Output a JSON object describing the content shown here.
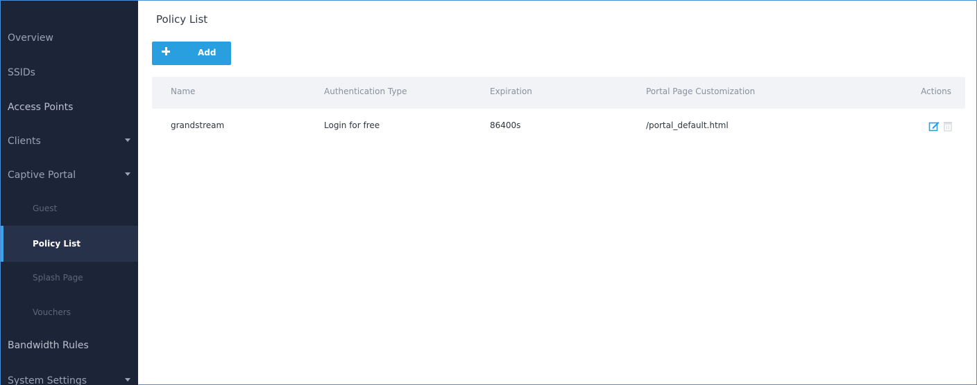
{
  "sidebar": {
    "items": [
      {
        "label": "Overview"
      },
      {
        "label": "SSIDs"
      },
      {
        "label": "Access Points"
      },
      {
        "label": "Clients"
      },
      {
        "label": "Captive Portal"
      },
      {
        "label": "Guest"
      },
      {
        "label": "Policy List"
      },
      {
        "label": "Splash Page"
      },
      {
        "label": "Vouchers"
      },
      {
        "label": "Bandwidth Rules"
      },
      {
        "label": "System Settings"
      }
    ]
  },
  "main": {
    "title": "Policy List",
    "add_label": "Add"
  },
  "table": {
    "columns": [
      "Name",
      "Authentication Type",
      "Expiration",
      "Portal Page Customization",
      "Actions"
    ],
    "rows": [
      {
        "name": "grandstream",
        "auth": "Login for free",
        "expiration": "86400s",
        "portal": "/portal_default.html"
      }
    ]
  },
  "colors": {
    "sidebar_bg": "#1c2538",
    "accent": "#2a9fe0",
    "active_item_bg": "#27324a"
  },
  "icons": [
    "plus-icon",
    "chevron-down-icon",
    "edit-icon",
    "trash-icon"
  ]
}
